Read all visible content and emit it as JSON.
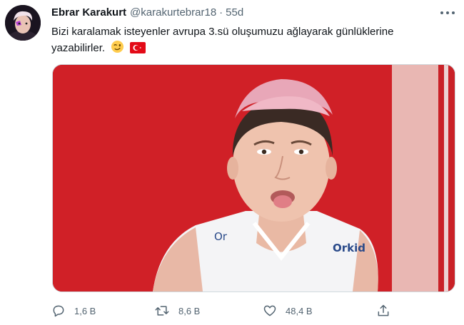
{
  "tweet": {
    "display_name": "Ebrar Karakurt",
    "handle": "@karakurtebrar18",
    "separator": "·",
    "time": "55d",
    "text_line1": "Bizi karalamak isteyenler avrupa 3.sü oluşumuzu ağlayarak günlüklerine",
    "text_line2": "yazabilirler.",
    "emojis": [
      "winking-face-emoji",
      "turkey-flag-emoji"
    ]
  },
  "media": {
    "jersey_text_left": "Or",
    "jersey_text_right": "Orkid"
  },
  "actions": {
    "reply_count": "1,6 B",
    "retweet_count": "8,6 B",
    "like_count": "48,4 B"
  },
  "colors": {
    "text_primary": "#0f1419",
    "text_secondary": "#536471",
    "background_red": "#d52328",
    "hair_pink": "#e8a7b8"
  }
}
